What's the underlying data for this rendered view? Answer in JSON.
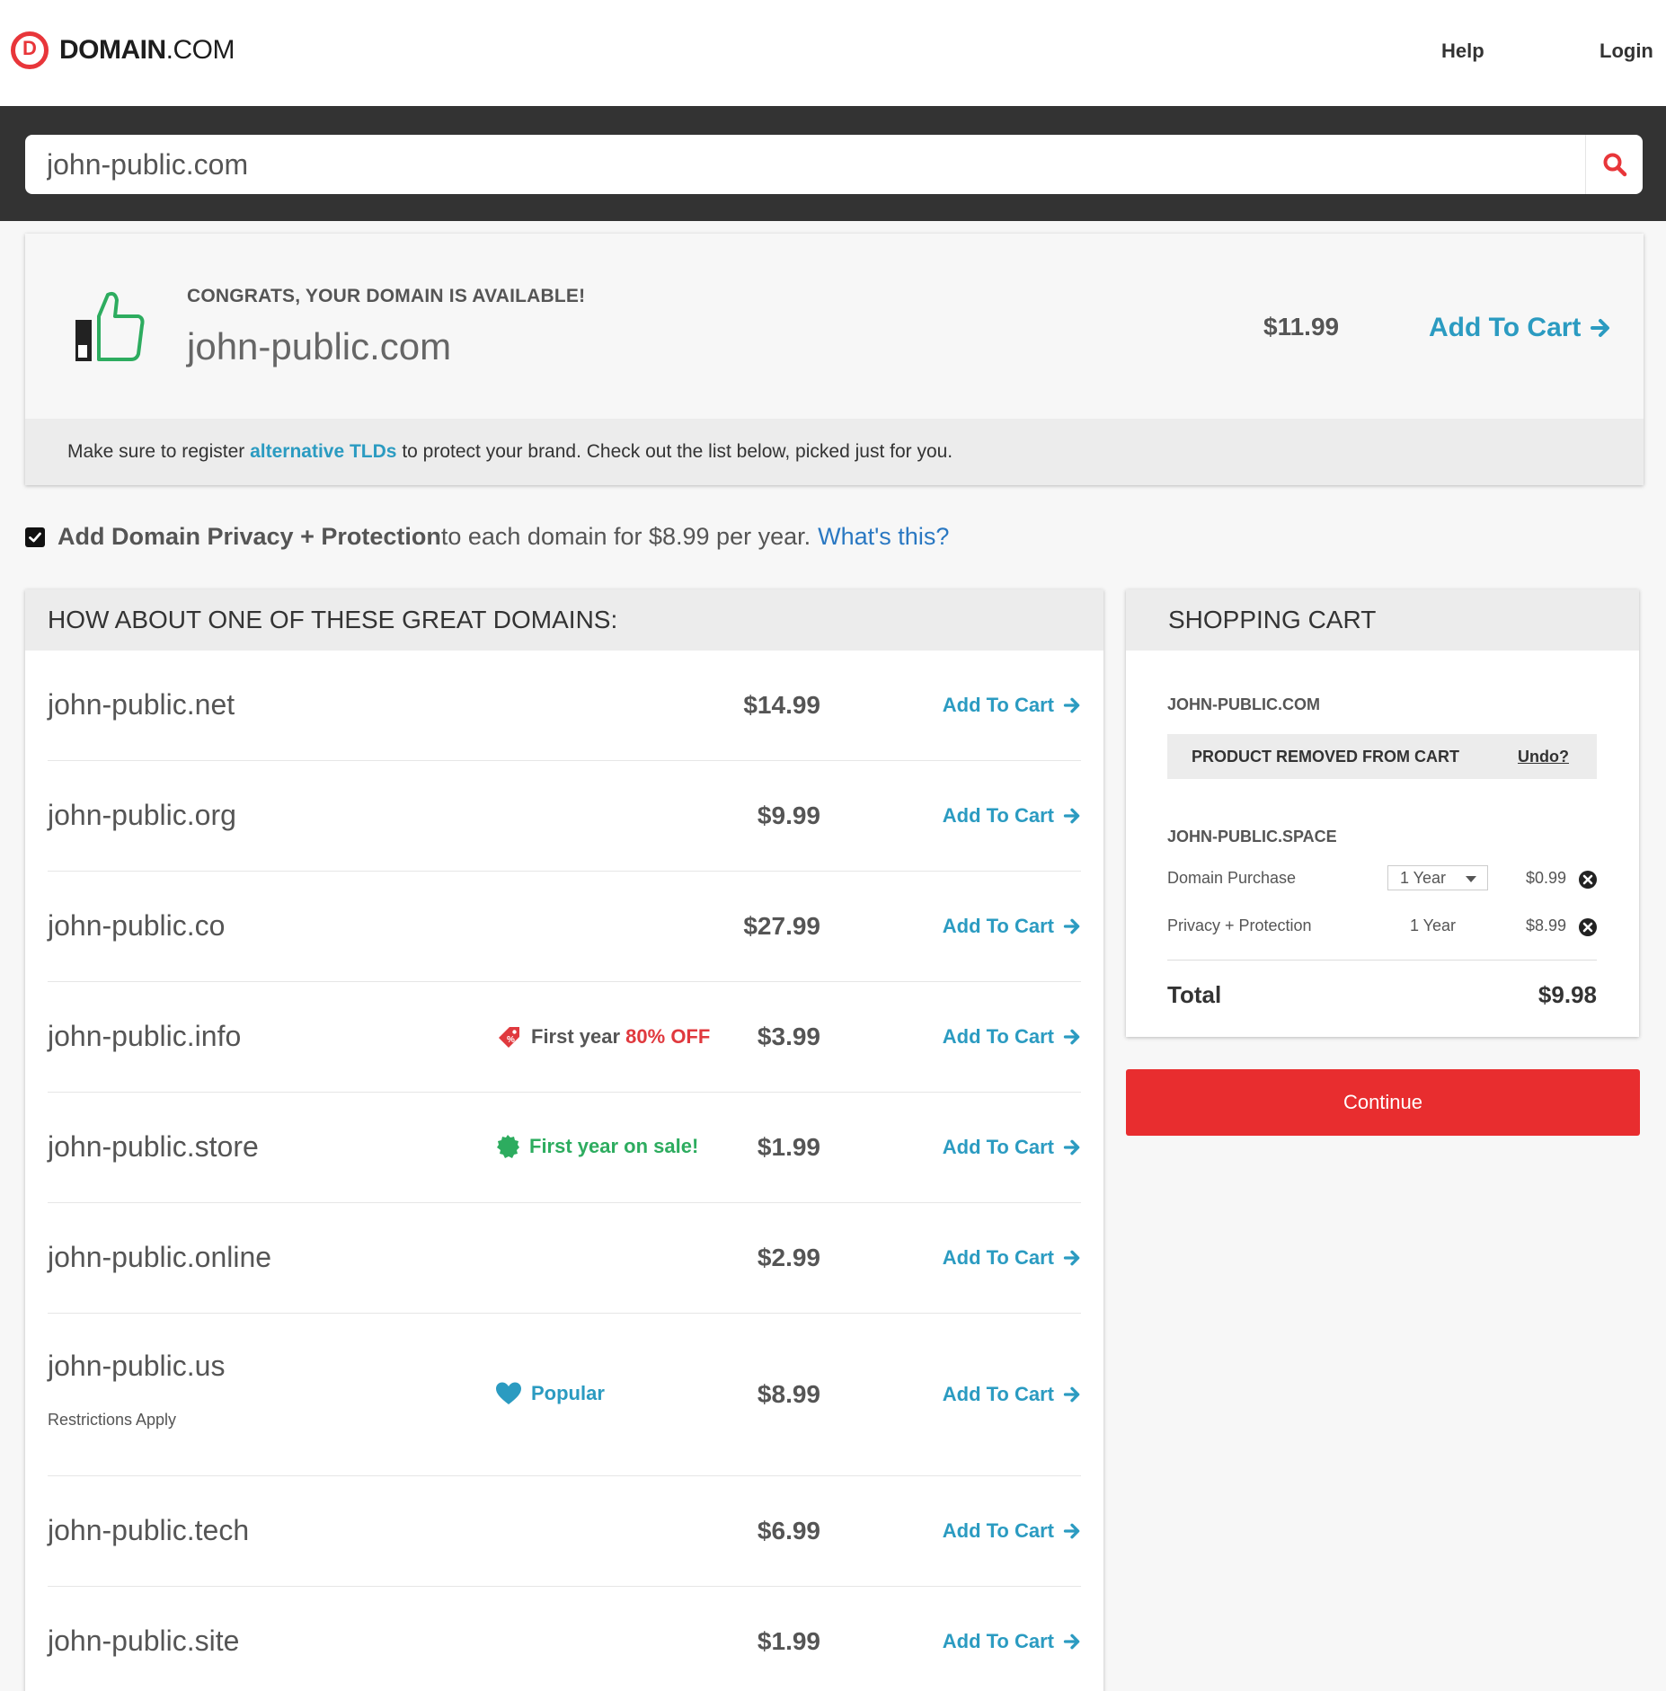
{
  "brand": {
    "name_bold": "DOMAIN",
    "name_rest": ".COM"
  },
  "nav": {
    "help": "Help",
    "login": "Login"
  },
  "search": {
    "value": "john-public.com",
    "placeholder": ""
  },
  "availability": {
    "headline": "CONGRATS, YOUR DOMAIN IS AVAILABLE!",
    "domain": "john-public.com",
    "price": "$11.99",
    "add_label": "Add To Cart",
    "note_before": "Make sure to register ",
    "note_link": "alternative TLDs",
    "note_after": " to protect your brand. Check out the list below, picked just for you."
  },
  "privacy": {
    "checked": true,
    "bold": "Add Domain Privacy + Protection",
    "text": " to each domain for $8.99 per year.",
    "link": "What's this?"
  },
  "suggestions": {
    "title": "HOW ABOUT ONE OF THESE GREAT DOMAINS:",
    "add_label": "Add To Cart",
    "rows": [
      {
        "domain": "john-public.net",
        "price": "$14.99"
      },
      {
        "domain": "john-public.org",
        "price": "$9.99"
      },
      {
        "domain": "john-public.co",
        "price": "$27.99"
      },
      {
        "domain": "john-public.info",
        "price": "$3.99",
        "badge_text": "First year ",
        "badge_highlight": "80% OFF",
        "badge_icon": "price-tag-icon"
      },
      {
        "domain": "john-public.store",
        "price": "$1.99",
        "badge_text": "First year on sale!",
        "badge_icon": "sale-seal-icon"
      },
      {
        "domain": "john-public.online",
        "price": "$2.99"
      },
      {
        "domain": "john-public.us",
        "price": "$8.99",
        "sub": "Restrictions Apply",
        "badge_text": "Popular",
        "badge_icon": "heart-icon"
      },
      {
        "domain": "john-public.tech",
        "price": "$6.99"
      },
      {
        "domain": "john-public.site",
        "price": "$1.99"
      }
    ]
  },
  "cart": {
    "title": "SHOPPING CART",
    "removed_domain": "JOHN-PUBLIC.COM",
    "removed_message": "PRODUCT REMOVED FROM CART",
    "undo": "Undo?",
    "domain": "JOHN-PUBLIC.SPACE",
    "lines": [
      {
        "label": "Domain Purchase",
        "term": "1 Year",
        "amount": "$0.99"
      },
      {
        "label": "Privacy + Protection",
        "term": "1 Year",
        "amount": "$8.99"
      }
    ],
    "total_label": "Total",
    "total": "$9.98",
    "continue_label": "Continue"
  },
  "colors": {
    "brand_red": "#e8363a",
    "link_blue": "#2b9bc1",
    "badge_red": "#e0393e",
    "badge_green": "#2dac5f",
    "continue_red": "#e82d2f"
  }
}
